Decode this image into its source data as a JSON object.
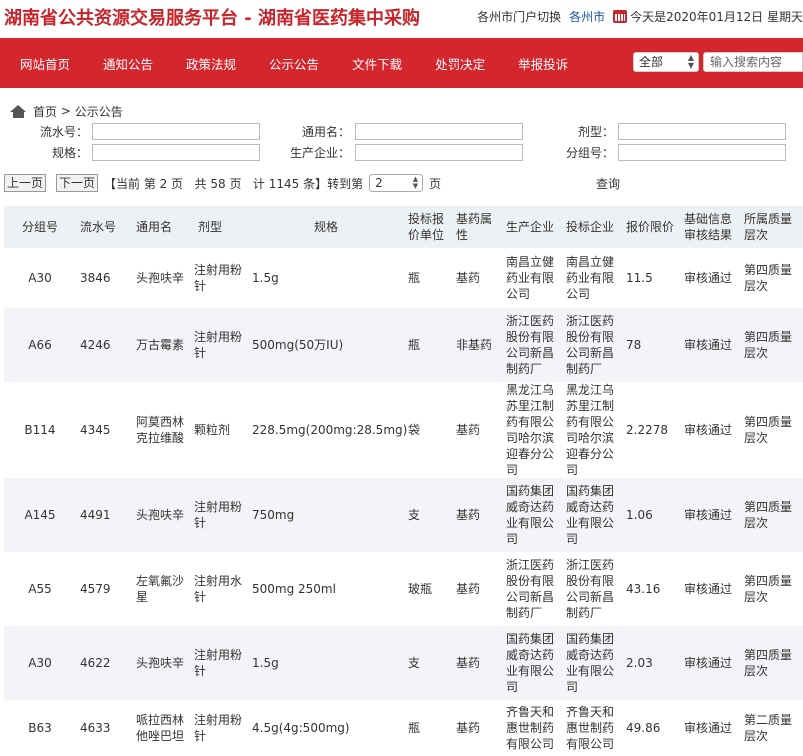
{
  "header": {
    "title": "湖南省公共资源交易服务平台 - 湖南省医药集中采购",
    "portal_switch": "各州市门户切换",
    "city": "各州市",
    "date": "今天是2020年01月12日 星期天"
  },
  "nav": {
    "items": [
      "网站首页",
      "通知公告",
      "政策法规",
      "公示公告",
      "文件下载",
      "处罚决定",
      "举报投诉"
    ],
    "scope_select": "全部",
    "search_placeholder": "输入搜索内容"
  },
  "breadcrumb": {
    "home": "首页",
    "sep": " > ",
    "current": "公示公告"
  },
  "filters": {
    "serial_no": "流水号：",
    "generic_name": "通用名：",
    "dosage_form": "剂型：",
    "spec": "规格：",
    "manufacturer": "生产企业：",
    "group_no": "分组号："
  },
  "pager": {
    "prev": "上一页",
    "next": "下一页",
    "info": "【当前 第 2 页   共 58 页   计 1145 条】转到第",
    "page_value": "2",
    "page_suffix": "页",
    "query": "查询"
  },
  "table": {
    "columns": [
      "分组号",
      "流水号",
      "通用名",
      "剂型",
      "规格",
      "投标报价单位",
      "基药属性",
      "生产企业",
      "投标企业",
      "报价限价",
      "基础信息审核结果",
      "所属质量层次"
    ],
    "rows": [
      [
        "A30",
        "3846",
        "头孢呋辛",
        "注射用粉针",
        "1.5g",
        "瓶",
        "基药",
        "南昌立健药业有限公司",
        "南昌立健药业有限公司",
        "11.5",
        "审核通过",
        "第四质量层次"
      ],
      [
        "A66",
        "4246",
        "万古霉素",
        "注射用粉针",
        "500mg(50万IU)",
        "瓶",
        "非基药",
        "浙江医药股份有限公司新昌制药厂",
        "浙江医药股份有限公司新昌制药厂",
        "78",
        "审核通过",
        "第四质量层次"
      ],
      [
        "B114",
        "4345",
        "阿莫西林克拉维酸",
        "颗粒剂",
        "228.5mg(200mg:28.5mg)",
        "袋",
        "基药",
        "黑龙江乌苏里江制药有限公司哈尔滨迎春分公司",
        "黑龙江乌苏里江制药有限公司哈尔滨迎春分公司",
        "2.2278",
        "审核通过",
        "第四质量层次"
      ],
      [
        "A145",
        "4491",
        "头孢呋辛",
        "注射用粉针",
        "750mg",
        "支",
        "基药",
        "国药集团威奇达药业有限公司",
        "国药集团威奇达药业有限公司",
        "1.06",
        "审核通过",
        "第四质量层次"
      ],
      [
        "A55",
        "4579",
        "左氧氟沙星",
        "注射用水针",
        "500mg 250ml",
        "玻瓶",
        "基药",
        "浙江医药股份有限公司新昌制药厂",
        "浙江医药股份有限公司新昌制药厂",
        "43.16",
        "审核通过",
        "第四质量层次"
      ],
      [
        "A30",
        "4622",
        "头孢呋辛",
        "注射用粉针",
        "1.5g",
        "支",
        "基药",
        "国药集团威奇达药业有限公司",
        "国药集团威奇达药业有限公司",
        "2.03",
        "审核通过",
        "第四质量层次"
      ],
      [
        "B63",
        "4633",
        "哌拉西林他唑巴坦",
        "注射用粉针",
        "4.5g(4g:500mg)",
        "瓶",
        "基药",
        "齐鲁天和惠世制药有限公司",
        "齐鲁天和惠世制药有限公司",
        "49.86",
        "审核通过",
        "第二质量层次"
      ]
    ]
  }
}
